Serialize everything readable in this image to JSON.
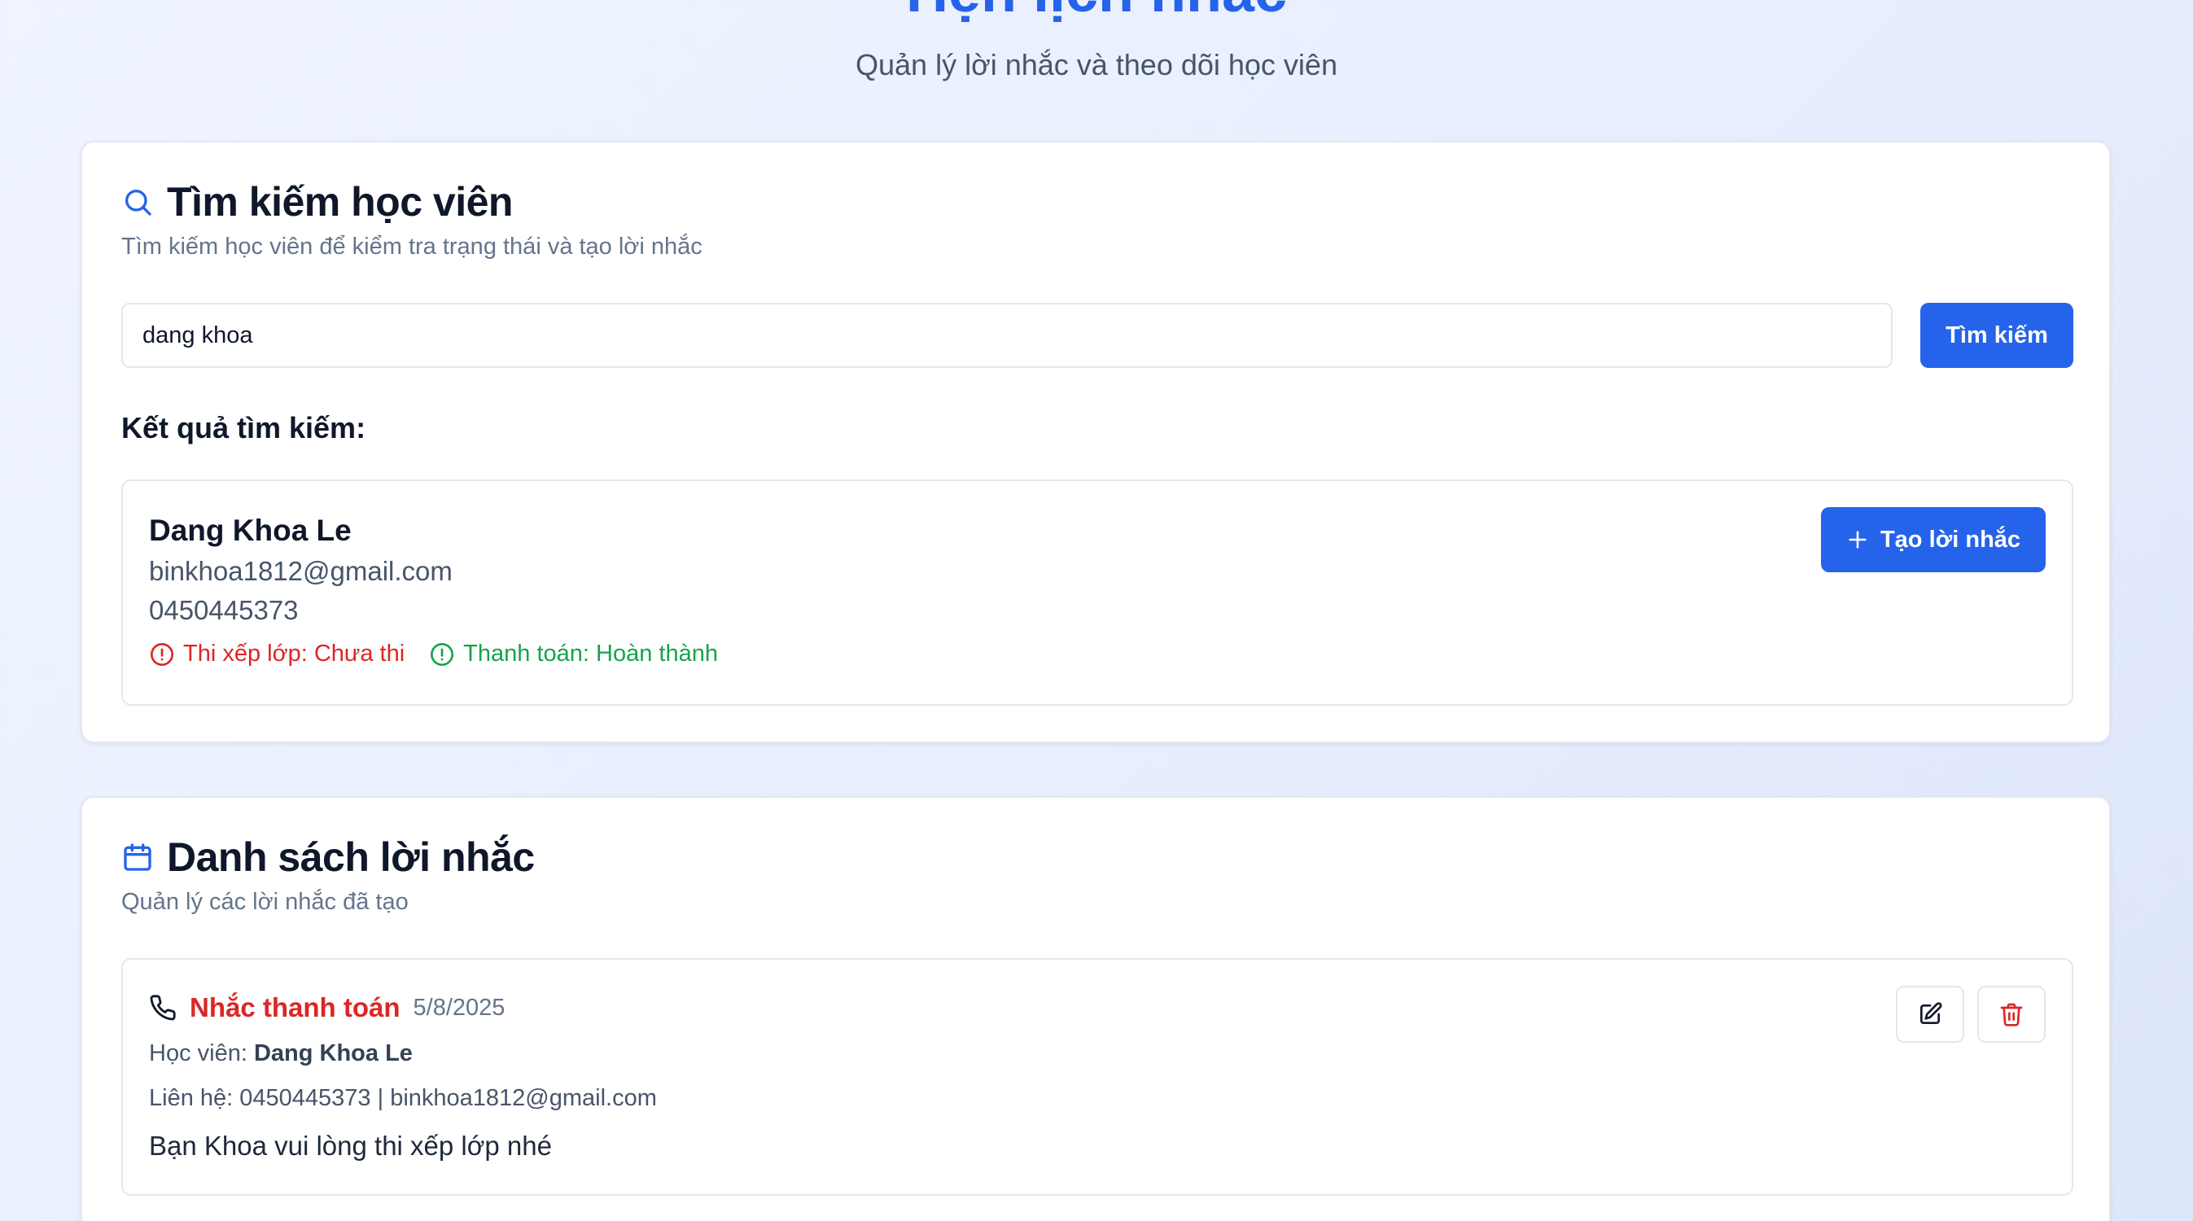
{
  "header": {
    "title": "Hẹn lịch nhắc",
    "subtitle": "Quản lý lời nhắc và theo dõi học viên"
  },
  "search_section": {
    "icon": "search-icon",
    "title": "Tìm kiếm học viên",
    "description": "Tìm kiếm học viên để kiểm tra trạng thái và tạo lời nhắc",
    "input_value": "dang khoa",
    "button_label": "Tìm kiếm",
    "results_heading": "Kết quả tìm kiếm:",
    "results": [
      {
        "name": "Dang Khoa Le",
        "email": "binkhoa1812@gmail.com",
        "phone": "0450445373",
        "statuses": [
          {
            "label": "Thi xếp lớp: Chưa thi",
            "color": "#dc2626",
            "icon": "alert-circle-icon"
          },
          {
            "label": "Thanh toán: Hoàn thành",
            "color": "#16a34a",
            "icon": "alert-circle-icon"
          }
        ],
        "create_label": "Tạo lời nhắc",
        "create_icon": "plus-icon"
      }
    ]
  },
  "reminders_section": {
    "icon": "calendar-icon",
    "title": "Danh sách lời nhắc",
    "description": "Quản lý các lời nhắc đã tạo",
    "items": [
      {
        "icon": "phone-icon",
        "type": "Nhắc thanh toán",
        "date": "5/8/2025",
        "student_prefix": "Học viên:",
        "student_name": "Dang Khoa Le",
        "contact": "Liên hệ: 0450445373 | binkhoa1812@gmail.com",
        "note": "Bạn Khoa vui lòng thi xếp lớp nhé",
        "actions": [
          "edit-icon",
          "trash-icon"
        ]
      }
    ]
  },
  "colors": {
    "primary": "#2563eb",
    "danger": "#dc2626",
    "success": "#16a34a"
  }
}
